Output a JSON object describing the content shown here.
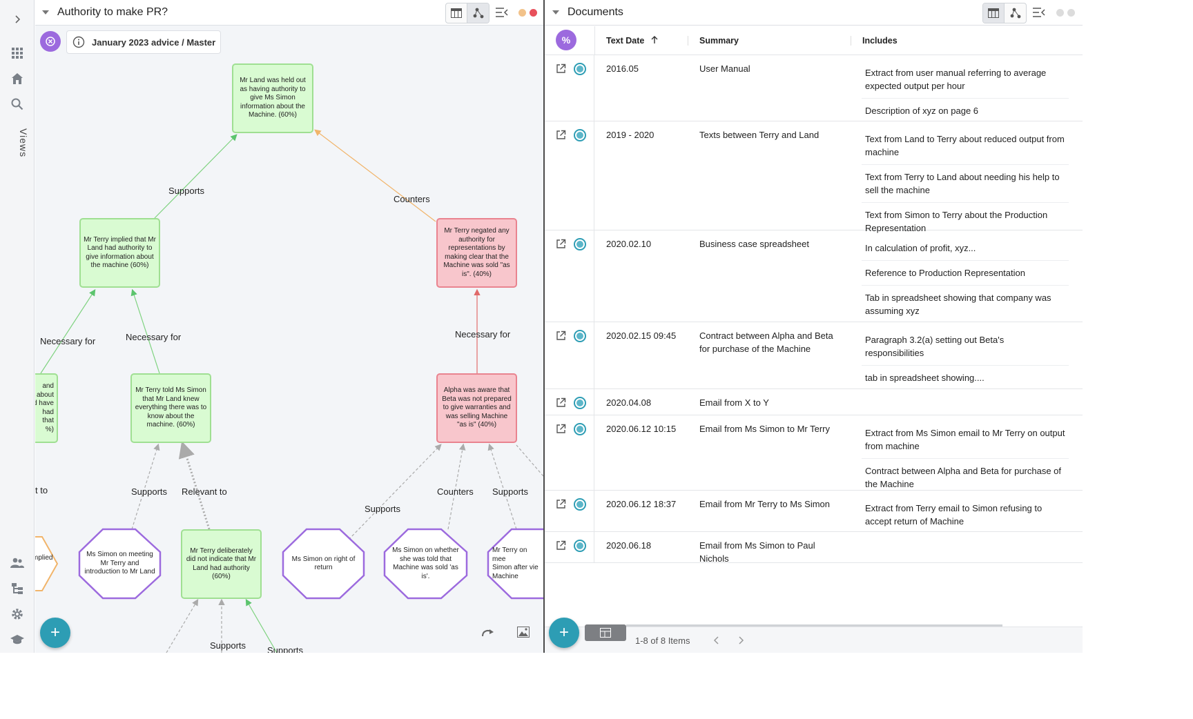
{
  "left_panel": {
    "title": "Authority to make PR?",
    "breadcrumb": "January 2023 advice / Master",
    "nodes": {
      "n1": "Mr Land was held out as having authority to give Ms Simon information about the Machine. (60%)",
      "n2": "Mr Terry implied that Mr Land had authority to give information about the machine (60%)",
      "n3": "Mr Terry negated any authority for representations by making clear that the Machine was sold \"as is\". (40%)",
      "n4": "Mr Terry told Ms Simon that Mr Land knew everything there was to know about the machine. (60%)",
      "n5": "Alpha was aware that Beta was not prepared to give warranties and was selling Machine \"as is\" (40%)",
      "n6": "Mr Terry deliberately did not indicate that Mr Land had authority (60%)",
      "n7": "and\nabout\nd have\nhad\nthat\n%)",
      "h1": "Ms Simon on meeting Mr Terry and introduction to Mr Land",
      "h2": "Ms Simon on right of return",
      "h3": "Ms Simon on whether she was told that Machine was sold 'as is'.",
      "h4": "Mr Terry on mee\nSimon after vie\nMachine",
      "h0": "mplied"
    },
    "edge_labels": {
      "e1": "Supports",
      "e2": "Counters",
      "e3": "Necessary for",
      "e4": "Necessary for",
      "e5": "Necessary for",
      "e6": "Supports",
      "e7": "Relevant to",
      "e8": "Supports",
      "e9": "Counters",
      "e10": "Supports",
      "e11": "t to",
      "e12": "Supports",
      "e13": "Supports"
    },
    "add_button": "+"
  },
  "right_panel": {
    "title": "Documents",
    "columns": {
      "date": "Text Date",
      "summary": "Summary",
      "includes": "Includes"
    },
    "pct_button": "%",
    "rows": [
      {
        "date": "2016.05",
        "summary": "User Manual",
        "includes": [
          "Extract from user manual referring to average expected output per hour",
          "Description of xyz on page 6"
        ]
      },
      {
        "date": "2019 - 2020",
        "summary": "Texts between Terry and Land",
        "includes": [
          "Text from Land to Terry about reduced output from machine",
          "Text from Terry to Land about needing his help to sell the machine",
          "Text from Simon to Terry about the Production Representation"
        ]
      },
      {
        "date": "2020.02.10",
        "summary": "Business case spreadsheet",
        "includes": [
          "In calculation of profit, xyz...",
          "Reference to Production Representation",
          "Tab in spreadsheet showing that company was assuming xyz"
        ]
      },
      {
        "date": "2020.02.15 09:45",
        "summary": "Contract between Alpha and Beta for purchase of the Machine",
        "includes": [
          "Paragraph 3.2(a) setting out Beta's responsibilities",
          "tab in spreadsheet showing...."
        ]
      },
      {
        "date": "2020.04.08",
        "summary": "Email from X to Y",
        "includes": []
      },
      {
        "date": "2020.06.12 10:15",
        "summary": "Email from Ms Simon to Mr Terry",
        "includes": [
          "Extract from Ms Simon email to Mr Terry on output from machine",
          "Contract between Alpha and Beta for purchase of the Machine"
        ]
      },
      {
        "date": "2020.06.12 18:37",
        "summary": "Email from Mr Terry to Ms Simon",
        "includes": [
          "Extract from Terry email to Simon refusing to accept return of Machine"
        ]
      },
      {
        "date": "2020.06.18",
        "summary": "Email from Ms Simon to Paul Nichols",
        "includes": []
      }
    ],
    "pager": "1-8 of 8 Items",
    "add_button": "+"
  },
  "sidebar": {
    "views_label": "Views"
  },
  "colors": {
    "accent": "#2d9db4",
    "purple": "#9c6ade",
    "green_node": "#d9fbd2",
    "red_node": "#f8c6cc"
  }
}
